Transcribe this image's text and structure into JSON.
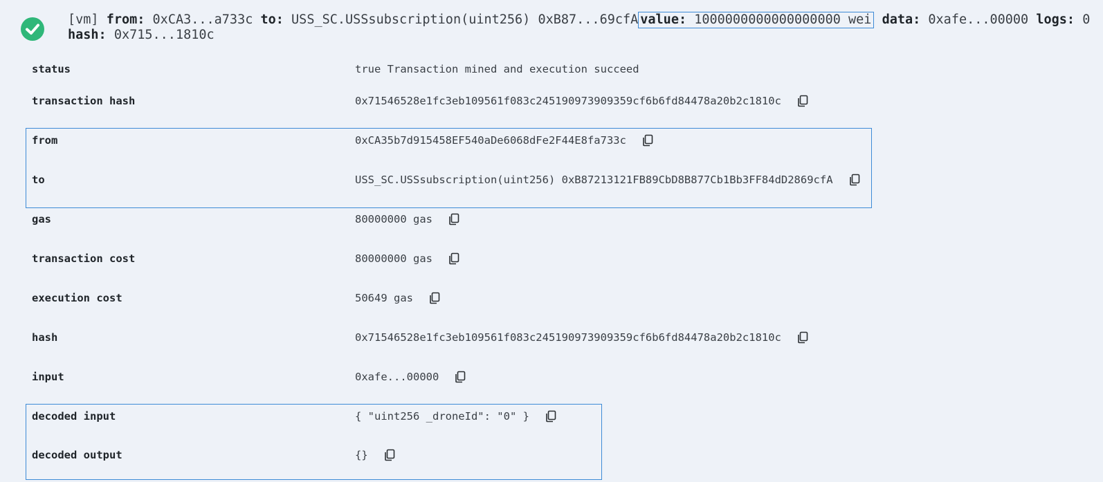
{
  "summary": {
    "vm_tag": "[vm]",
    "from_key": "from:",
    "from_value": "0xCA3...a733c",
    "to_key": "to:",
    "to_value": "USS_SC.USSsubscription(uint256) 0xB87...69cfA",
    "value_key": "value:",
    "value_value": "1000000000000000000 wei",
    "data_key": "data:",
    "data_value": "0xafe...00000",
    "logs_key": "logs:",
    "logs_value": "0",
    "hash_key": "hash:",
    "hash_value": "0x715...1810c"
  },
  "rows": [
    {
      "label": "status",
      "value": "true Transaction mined and execution succeed",
      "copy": false
    },
    {
      "label": "transaction hash",
      "value": "0x71546528e1fc3eb109561f083c245190973909359cf6b6fd84478a20b2c1810c",
      "copy": true
    },
    {
      "label": "from",
      "value": "0xCA35b7d915458EF540aDe6068dFe2F44E8fa733c",
      "copy": true
    },
    {
      "label": "to",
      "value": "USS_SC.USSsubscription(uint256) 0xB87213121FB89CbD8B877Cb1Bb3FF84dD2869cfA",
      "copy": true
    },
    {
      "label": "gas",
      "value": "80000000 gas",
      "copy": true
    },
    {
      "label": "transaction cost",
      "value": "80000000 gas",
      "copy": true
    },
    {
      "label": "execution cost",
      "value": "50649 gas",
      "copy": true
    },
    {
      "label": "hash",
      "value": "0x71546528e1fc3eb109561f083c245190973909359cf6b6fd84478a20b2c1810c",
      "copy": true
    },
    {
      "label": "input",
      "value": "0xafe...00000",
      "copy": true
    },
    {
      "label": "decoded input",
      "value": "{ \"uint256 _droneId\": \"0\" }",
      "copy": true
    },
    {
      "label": "decoded output",
      "value": "{}",
      "copy": true
    }
  ],
  "colors": {
    "background": "#eef2f8",
    "success": "#2fb779",
    "highlight_border": "#3c8ad6"
  },
  "icons": {
    "status": "check-circle-icon",
    "copy": "copy-icon"
  }
}
